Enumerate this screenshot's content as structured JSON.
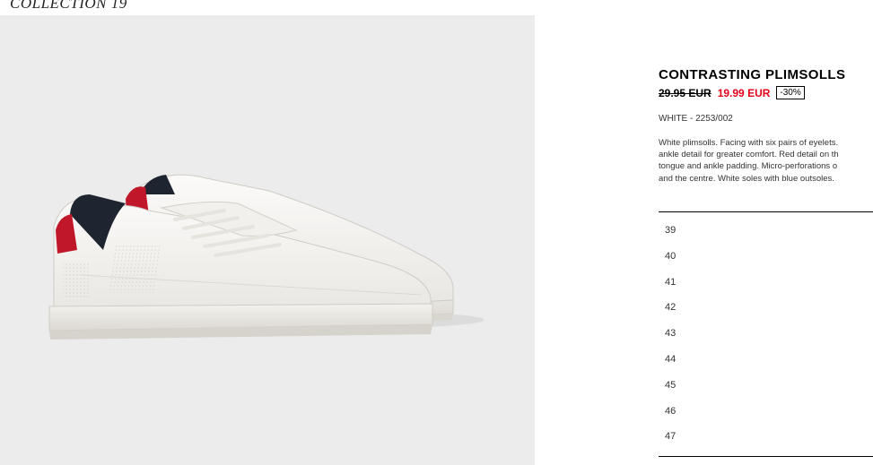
{
  "header": {
    "collection_label": "COLLECTION 19"
  },
  "product": {
    "title": "CONTRASTING PLIMSOLLS",
    "old_price": "29.95 EUR",
    "new_price": "19.99 EUR",
    "discount": "-30%",
    "color_ref": "WHITE - 2253/002",
    "description": "White plimsolls. Facing with six pairs of eyelets.\nankle detail for greater comfort. Red detail on th\ntongue and ankle padding. Micro-perforations o\nand the centre. White soles with blue outsoles.",
    "image_alt": "product-photo-white-plimsolls"
  },
  "sizes": [
    "39",
    "40",
    "41",
    "42",
    "43",
    "44",
    "45",
    "46",
    "47"
  ],
  "colors": {
    "sale_red": "#e2001a",
    "image_background": "#ececec",
    "shoe_white": "#f7f6f4",
    "collar_navy": "#1f2530",
    "heel_red": "#c0182a"
  }
}
